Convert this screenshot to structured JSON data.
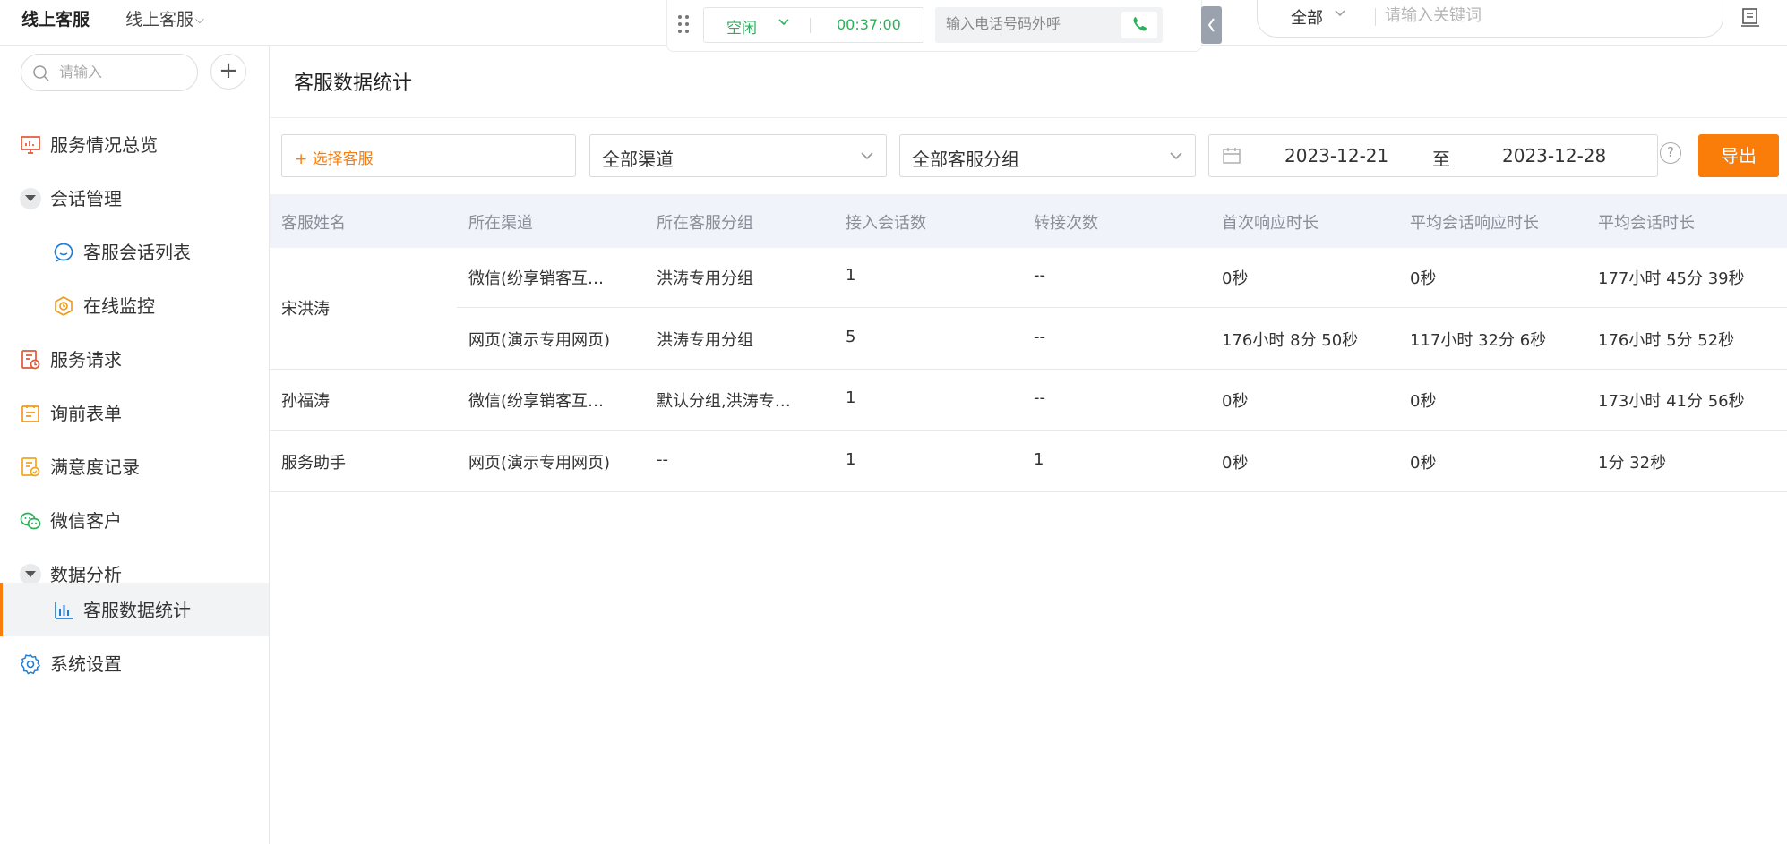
{
  "topbar": {
    "brand": "线上客服",
    "brand_sub": "线上客服",
    "status": "空闲",
    "timer": "00:37:00",
    "phone_placeholder": "输入电话号码外呼",
    "search_scope": "全部",
    "search_placeholder": "请输入关键词"
  },
  "sidebar": {
    "search_placeholder": "请输入",
    "items": [
      {
        "label": "服务情况总览",
        "icon": "overview-icon"
      },
      {
        "label": "会话管理",
        "icon": "expand-caret-icon"
      },
      {
        "label": "客服会话列表",
        "icon": "chat-bubble-icon"
      },
      {
        "label": "在线监控",
        "icon": "monitor-icon"
      },
      {
        "label": "服务请求",
        "icon": "service-request-icon"
      },
      {
        "label": "询前表单",
        "icon": "form-icon"
      },
      {
        "label": "满意度记录",
        "icon": "satisfaction-icon"
      },
      {
        "label": "微信客户",
        "icon": "wechat-icon"
      },
      {
        "label": "数据分析",
        "icon": "expand-caret-icon"
      },
      {
        "label": "客服数据统计",
        "icon": "bar-chart-icon"
      },
      {
        "label": "系统设置",
        "icon": "gear-icon"
      }
    ]
  },
  "main": {
    "title": "客服数据统计",
    "filters": {
      "agent_select": "+ 选择客服",
      "channel": "全部渠道",
      "group": "全部客服分组",
      "date_start": "2023-12-21",
      "date_sep": "至",
      "date_end": "2023-12-28",
      "help": "?",
      "export": "导出"
    },
    "table": {
      "headers": [
        "客服姓名",
        "所在渠道",
        "所在客服分组",
        "接入会话数",
        "转接次数",
        "首次响应时长",
        "平均会话响应时长",
        "平均会话时长"
      ],
      "rows": [
        {
          "name": "宋洪涛",
          "subrows": [
            [
              "微信(纷享销客互…",
              "洪涛专用分组",
              "1",
              "--",
              "0秒",
              "0秒",
              "177小时 45分 39秒"
            ],
            [
              "网页(演示专用网页)",
              "洪涛专用分组",
              "5",
              "--",
              "176小时 8分 50秒",
              "117小时 32分 6秒",
              "176小时 5分 52秒"
            ]
          ]
        },
        {
          "name": "孙福涛",
          "subrows": [
            [
              "微信(纷享销客互…",
              "默认分组,洪涛专…",
              "1",
              "--",
              "0秒",
              "0秒",
              "173小时 41分 56秒"
            ]
          ]
        },
        {
          "name": "服务助手",
          "subrows": [
            [
              "网页(演示专用网页)",
              "--",
              "1",
              "1",
              "0秒",
              "0秒",
              "1分 32秒"
            ]
          ]
        }
      ]
    }
  },
  "colors": {
    "accent": "#fa7d0a",
    "status_green": "#2bb15a",
    "header_bg": "#f0f3f9"
  }
}
